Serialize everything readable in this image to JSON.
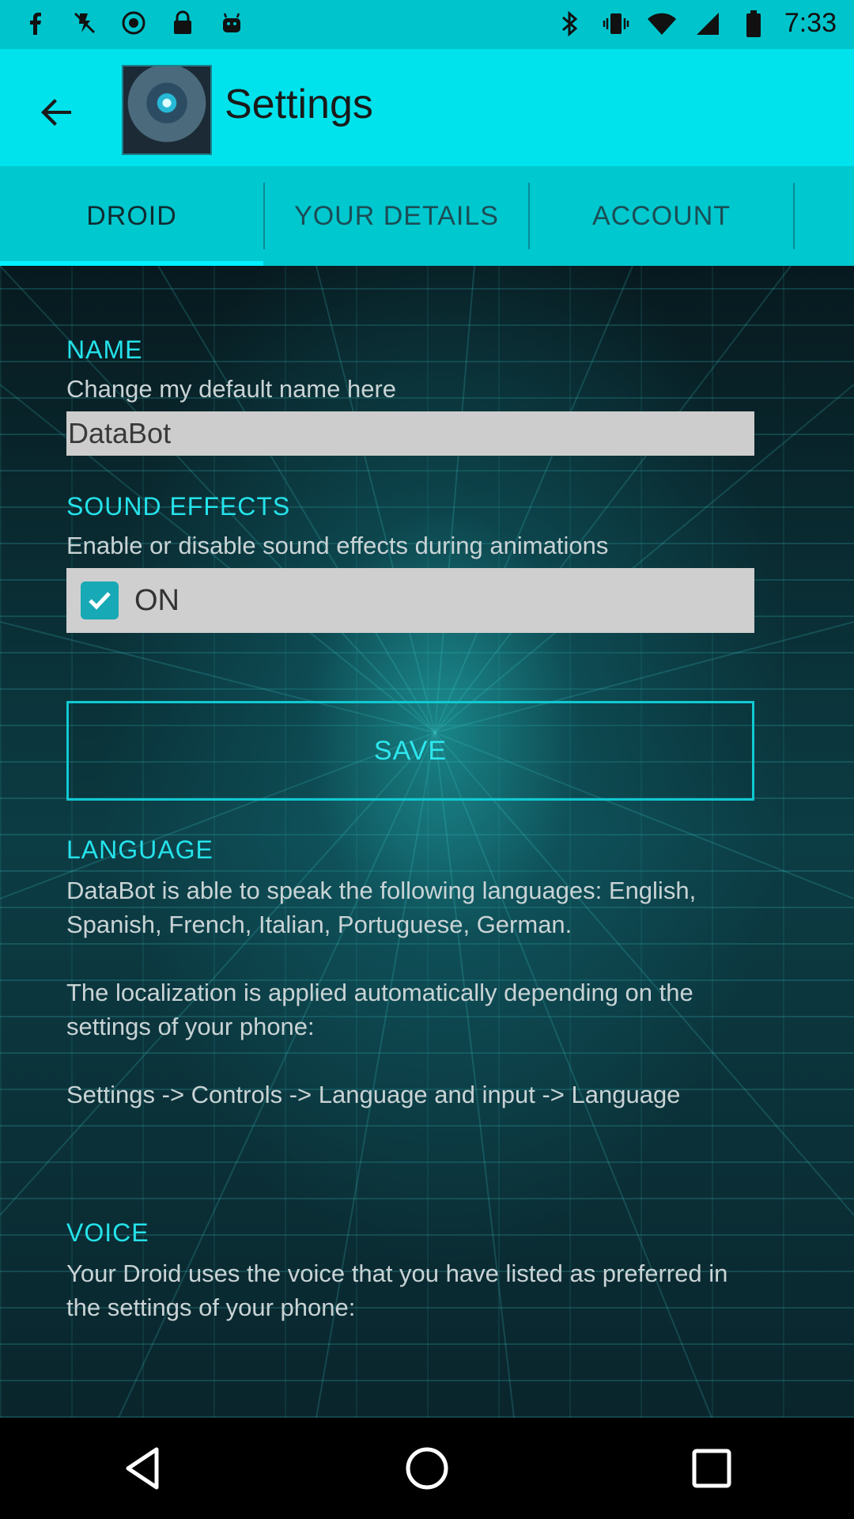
{
  "status_bar": {
    "time": "7:33",
    "icons": [
      "facebook-icon",
      "flash-off-icon",
      "record-icon",
      "lock-icon",
      "android-icon",
      "bluetooth-icon",
      "vibrate-icon",
      "wifi-icon",
      "signal-icon",
      "battery-icon"
    ]
  },
  "app_bar": {
    "title": "Settings"
  },
  "tabs": [
    {
      "label": "DROID",
      "active": true
    },
    {
      "label": "YOUR DETAILS",
      "active": false
    },
    {
      "label": "ACCOUNT",
      "active": false
    }
  ],
  "name_section": {
    "title": "NAME",
    "description": "Change my default name here",
    "value": "DataBot"
  },
  "sound_section": {
    "title": "SOUND EFFECTS",
    "description": "Enable or disable sound effects during animations",
    "toggle_label": "ON",
    "checked": true
  },
  "save_label": "SAVE",
  "language_section": {
    "title": "LANGUAGE",
    "description": "DataBot is able to speak the following languages: English, Spanish, French, Italian, Portuguese, German.\n\n The localization is applied automatically depending on the settings of your phone:\n\n Settings -> Controls -> Language and input -> Language"
  },
  "voice_section": {
    "title": "VOICE",
    "description": "Your Droid uses the voice that you have listed as preferred in the settings of your phone:"
  },
  "colors": {
    "accent": "#00e3ec",
    "tab_bar": "#00c8cf",
    "section_title": "#25e2ea"
  }
}
